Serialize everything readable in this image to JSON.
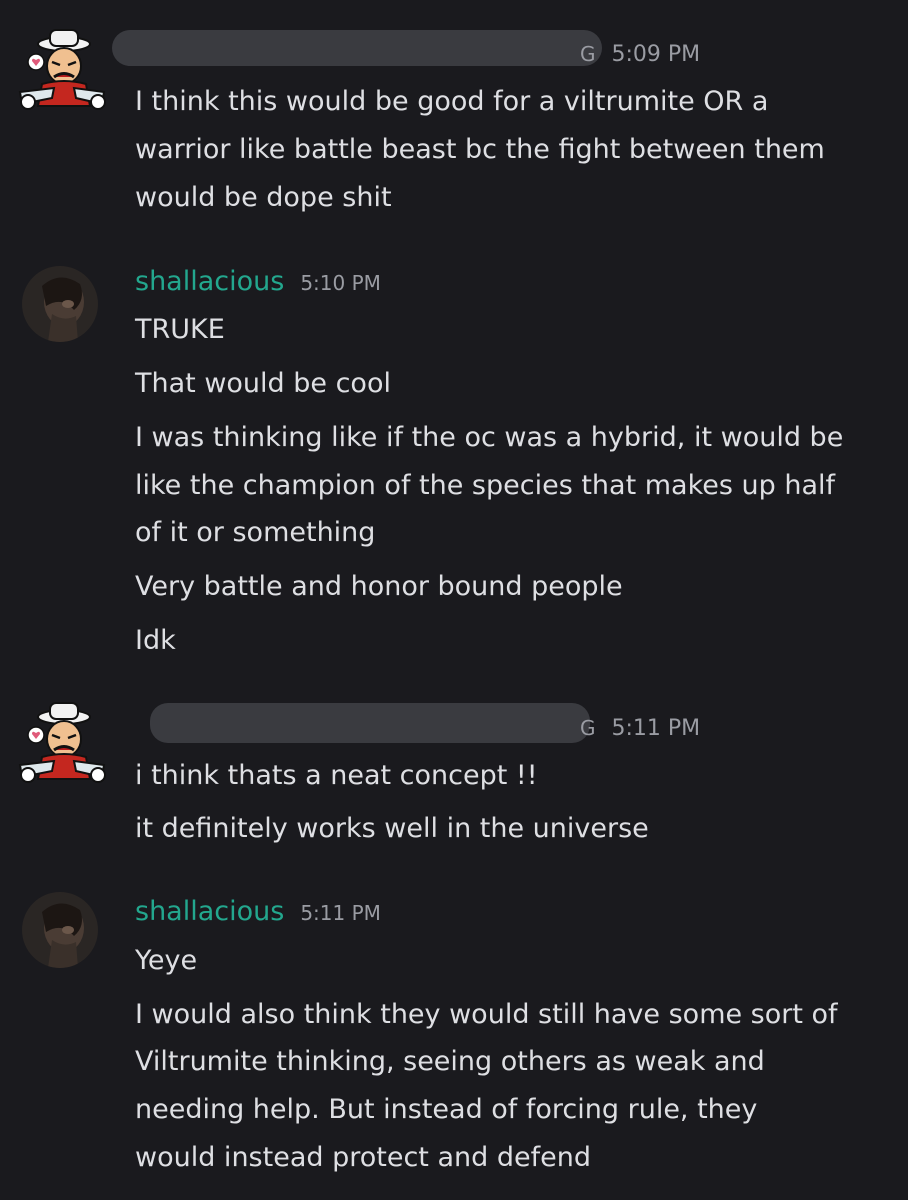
{
  "messages": [
    {
      "username": "",
      "username_tail": "G",
      "timestamp": "5:09 PM",
      "lines": [
        "I think this would be good for a viltrumite OR a",
        "warrior like battle beast bc the fight between them",
        "would be dope shit"
      ]
    },
    {
      "username": "shallacious",
      "timestamp": "5:10 PM",
      "lines": [
        "TRUKE",
        "That would be cool",
        "I was thinking like if the oc was a hybrid, it would be",
        "like the champion of the species that makes up half",
        "of it or something",
        "Very battle and honor bound people",
        "Idk"
      ]
    },
    {
      "username": "",
      "username_tail": "G",
      "timestamp": "5:11 PM",
      "lines": [
        "i think thats a neat concept !!",
        "it definitely works well in the universe"
      ]
    },
    {
      "username": "shallacious",
      "timestamp": "5:11 PM",
      "lines": [
        "Yeye",
        "I would also think they would still have some sort of",
        "Viltrumite thinking, seeing others as weak and",
        "needing help. But instead of forcing rule, they",
        "would instead protect and defend"
      ]
    }
  ],
  "colors": {
    "background": "#1a1a1e",
    "username": "#23a78e",
    "text": "#dedfe3",
    "timestamp": "#9a9ca3",
    "redaction": "#3a3b40"
  },
  "icons": {
    "avatar_1": "cartoon-sticker-avatar-icon",
    "avatar_2": "dark-photo-avatar-icon"
  }
}
